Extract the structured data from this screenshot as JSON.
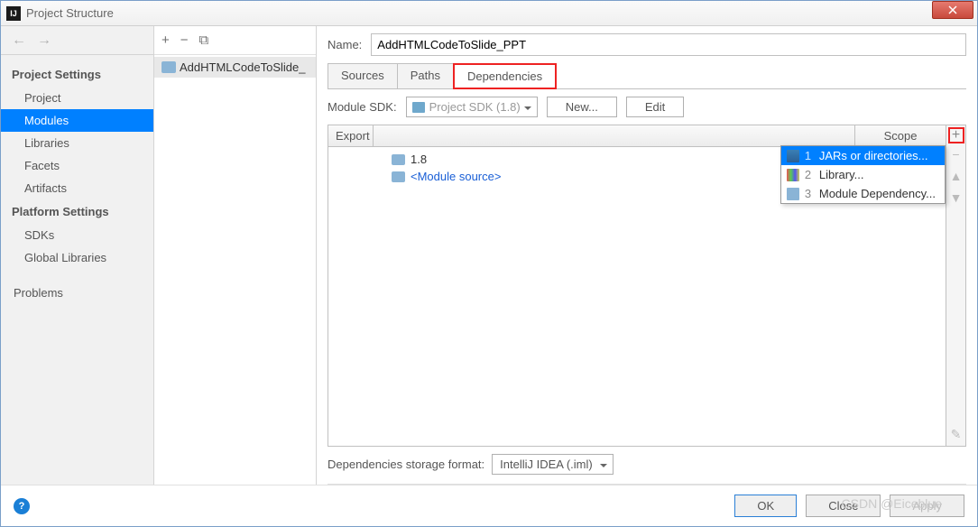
{
  "window": {
    "title": "Project Structure"
  },
  "sidebar": {
    "sections": [
      {
        "header": "Project Settings",
        "items": [
          {
            "label": "Project"
          },
          {
            "label": "Modules",
            "selected": true
          },
          {
            "label": "Libraries"
          },
          {
            "label": "Facets"
          },
          {
            "label": "Artifacts"
          }
        ]
      },
      {
        "header": "Platform Settings",
        "items": [
          {
            "label": "SDKs"
          },
          {
            "label": "Global Libraries"
          }
        ]
      }
    ],
    "extra": [
      {
        "label": "Problems"
      }
    ]
  },
  "tree": {
    "items": [
      {
        "label": "AddHTMLCodeToSlide_"
      }
    ]
  },
  "main": {
    "name_label": "Name:",
    "name_value": "AddHTMLCodeToSlide_PPT",
    "tabs": [
      {
        "label": "Sources"
      },
      {
        "label": "Paths"
      },
      {
        "label": "Dependencies",
        "active": true
      }
    ],
    "sdk_label": "Module SDK:",
    "sdk_value": "Project SDK (1.8)",
    "new_btn": "New...",
    "edit_btn": "Edit",
    "table_headers": {
      "export": "Export",
      "scope": "Scope"
    },
    "table_rows": [
      {
        "label": "1.8",
        "kind": "sdk"
      },
      {
        "label": "<Module source>",
        "kind": "module"
      }
    ],
    "popup": [
      {
        "num": "1",
        "label": "JARs or directories...",
        "selected": true
      },
      {
        "num": "2",
        "label": "Library..."
      },
      {
        "num": "3",
        "label": "Module Dependency..."
      }
    ],
    "storage_label": "Dependencies storage format:",
    "storage_value": "IntelliJ IDEA (.iml)"
  },
  "footer": {
    "ok": "OK",
    "close": "Close",
    "apply": "Apply"
  },
  "watermark": "CSDN @Eiceblue"
}
